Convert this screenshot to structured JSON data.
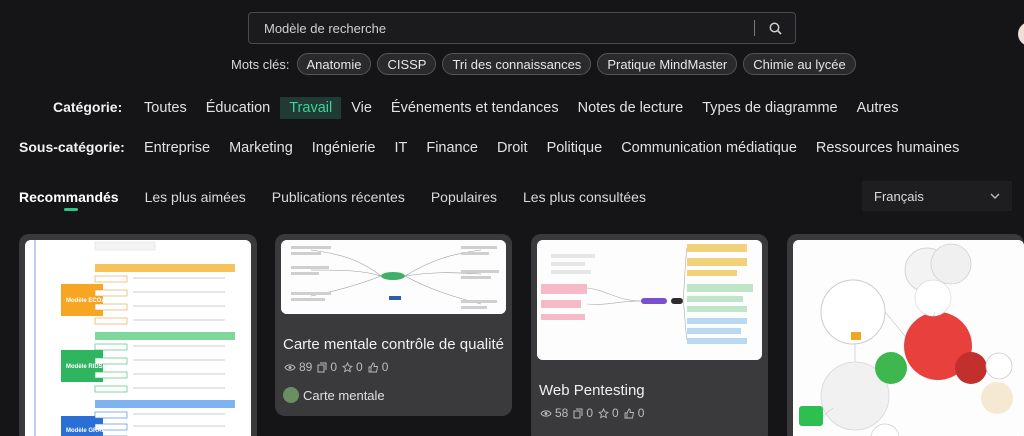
{
  "search": {
    "placeholder": "Modèle de recherche"
  },
  "keywords": {
    "label": "Mots clés:",
    "chips": [
      "Anatomie",
      "CISSP",
      "Tri des connaissances",
      "Pratique MindMaster",
      "Chimie au lycée"
    ]
  },
  "categories": {
    "label": "Catégorie:",
    "items": [
      "Toutes",
      "Éducation",
      "Travail",
      "Vie",
      "Événements et tendances",
      "Notes de lecture",
      "Types de diagramme",
      "Autres"
    ],
    "active": "Travail"
  },
  "subcategories": {
    "label": "Sous-catégorie:",
    "items": [
      "Entreprise",
      "Marketing",
      "Ingénierie",
      "IT",
      "Finance",
      "Droit",
      "Politique",
      "Communication médiatique",
      "Ressources humaines"
    ]
  },
  "tabs": {
    "items": [
      "Recommandés",
      "Les plus aimées",
      "Publications récentes",
      "Populaires",
      "Les plus consultées"
    ],
    "active": "Recommandés"
  },
  "language": {
    "selected": "Français"
  },
  "cards": [
    {
      "title": "",
      "thumb_labels": [
        "Modèle ECOA",
        "Modèle RIDS",
        "Modèle GRAI"
      ]
    },
    {
      "title": "Carte mentale contrôle de qualité",
      "views": "89",
      "copies": "0",
      "stars": "0",
      "likes": "0",
      "author": "Carte mentale"
    },
    {
      "title": "Web Pentesting",
      "views": "58",
      "copies": "0",
      "stars": "0",
      "likes": "0"
    },
    {
      "title": ""
    }
  ],
  "colors": {
    "accent": "#2ec58c",
    "active_bg": "#1f3b33",
    "card_bg": "#3a3a3c",
    "page_bg": "#151517"
  }
}
